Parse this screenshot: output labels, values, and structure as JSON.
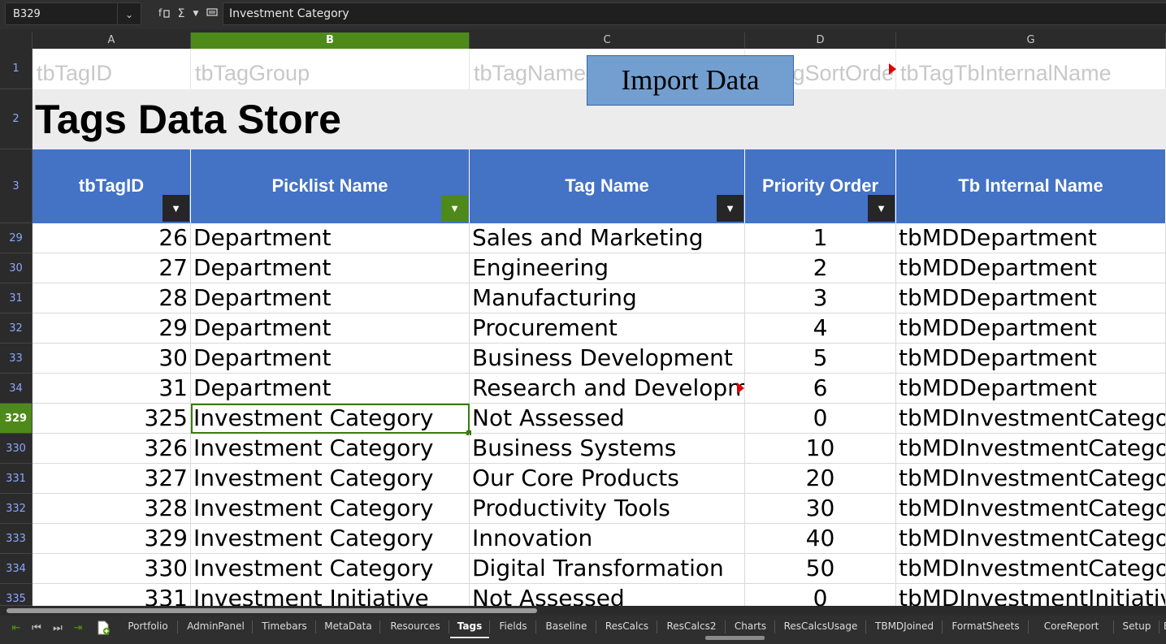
{
  "formula_bar": {
    "name_box": "B329",
    "formula": "Investment Category",
    "icons": [
      "function-wizard-icon",
      "sum-icon",
      "formula-icon"
    ]
  },
  "columns": [
    "A",
    "B",
    "C",
    "D",
    "G"
  ],
  "row1": [
    "tbTagID",
    "tbTagGroup",
    "tbTagName",
    "gSortOrde",
    "tbTagTbInternalName"
  ],
  "import_button": "Import Data",
  "title": "Tags Data Store",
  "headers": [
    "tbTagID",
    "Picklist Name",
    "Tag Name",
    "Priority Order",
    "Tb Internal Name"
  ],
  "header_row_labels": [
    "1",
    "2",
    "3"
  ],
  "rows": [
    {
      "row": "29",
      "id": "26",
      "group": "Department",
      "name": "Sales and Marketing",
      "order": "1",
      "internal": "tbMDDepartment"
    },
    {
      "row": "30",
      "id": "27",
      "group": "Department",
      "name": "Engineering",
      "order": "2",
      "internal": "tbMDDepartment"
    },
    {
      "row": "31",
      "id": "28",
      "group": "Department",
      "name": "Manufacturing",
      "order": "3",
      "internal": "tbMDDepartment"
    },
    {
      "row": "32",
      "id": "29",
      "group": "Department",
      "name": "Procurement",
      "order": "4",
      "internal": "tbMDDepartment"
    },
    {
      "row": "33",
      "id": "30",
      "group": "Department",
      "name": "Business Development",
      "order": "5",
      "internal": "tbMDDepartment"
    },
    {
      "row": "34",
      "id": "31",
      "group": "Department",
      "name": "Research and Developme",
      "order": "6",
      "internal": "tbMDDepartment"
    },
    {
      "row": "329",
      "id": "325",
      "group": "Investment Category",
      "name": "Not Assessed",
      "order": "0",
      "internal": "tbMDInvestmentCategory"
    },
    {
      "row": "330",
      "id": "326",
      "group": "Investment Category",
      "name": "Business Systems",
      "order": "10",
      "internal": "tbMDInvestmentCategory"
    },
    {
      "row": "331",
      "id": "327",
      "group": "Investment Category",
      "name": "Our Core Products",
      "order": "20",
      "internal": "tbMDInvestmentCategory"
    },
    {
      "row": "332",
      "id": "328",
      "group": "Investment Category",
      "name": "Productivity Tools",
      "order": "30",
      "internal": "tbMDInvestmentCategory"
    },
    {
      "row": "333",
      "id": "329",
      "group": "Investment Category",
      "name": "Innovation",
      "order": "40",
      "internal": "tbMDInvestmentCategory"
    },
    {
      "row": "334",
      "id": "330",
      "group": "Investment Category",
      "name": "Digital Transformation",
      "order": "50",
      "internal": "tbMDInvestmentCategory"
    },
    {
      "row": "335",
      "id": "331",
      "group": "Investment Initiative",
      "name": "Not Assessed",
      "order": "0",
      "internal": "tbMDInvestmentInitiative"
    }
  ],
  "selected_row": "329",
  "sheet_tabs": [
    "Portfolio",
    "AdminPanel",
    "Timebars",
    "MetaData",
    "Resources",
    "Tags",
    "Fields",
    "Baseline",
    "ResCalcs",
    "ResCalcs2",
    "Charts",
    "ResCalcsUsage",
    "TBMDJoined",
    "FormatSheets",
    "CoreReport",
    "Setup",
    "B"
  ],
  "active_tab": "Tags",
  "colors": {
    "header_blue": "#4472c4",
    "selection_green": "#4e8a1a",
    "button_blue": "#729fcf"
  }
}
